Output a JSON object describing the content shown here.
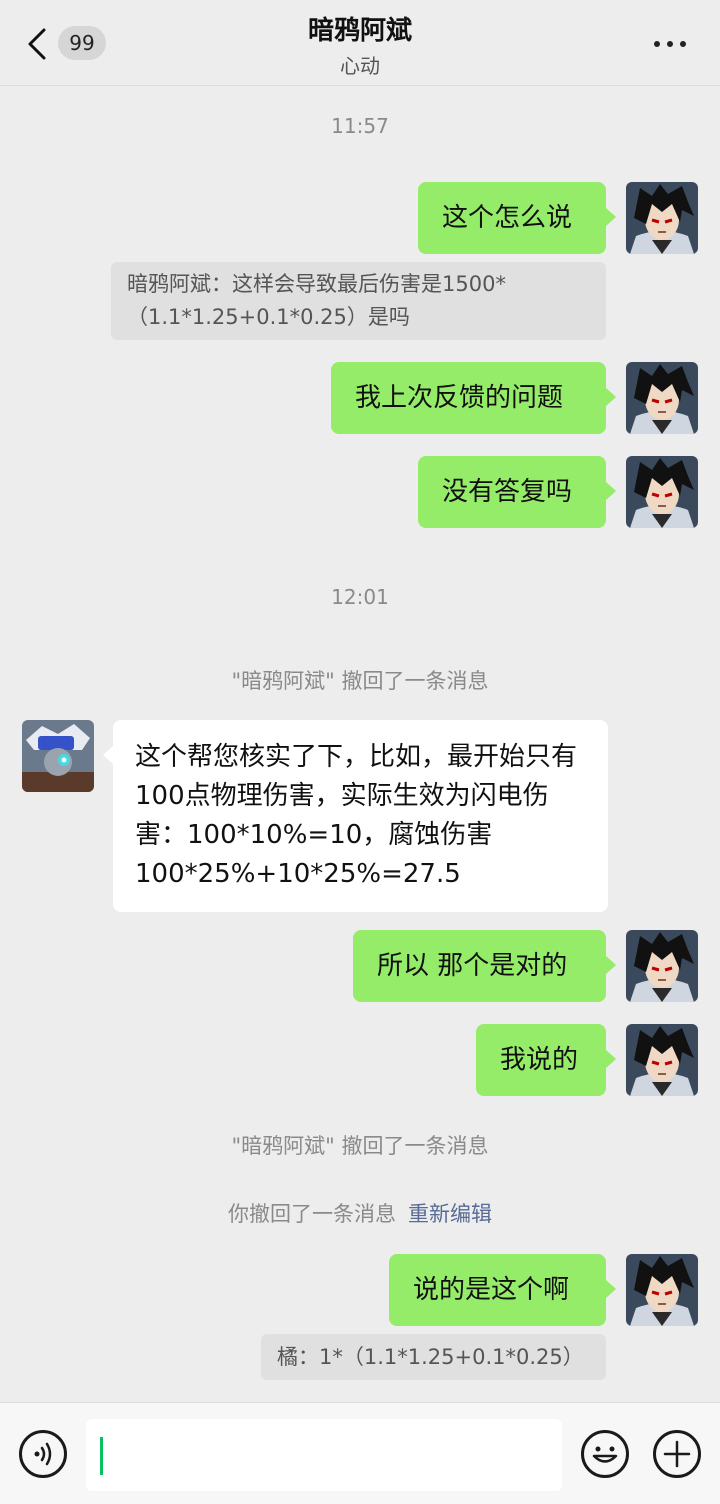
{
  "header": {
    "title": "暗鸦阿斌",
    "subtitle": "心动",
    "unread_badge": "99",
    "back_icon": "chevron-left-icon",
    "more_icon": "more-dots-icon"
  },
  "timestamps": [
    "11:57",
    "12:01"
  ],
  "messages": {
    "m1": "这个怎么说",
    "q1": "暗鸦阿斌：这样会导致最后伤害是1500*（1.1*1.25+0.1*0.25）是吗",
    "m2": "我上次反馈的问题",
    "m3": "没有答复吗",
    "recall1": "\"暗鸦阿斌\" 撤回了一条消息",
    "r1": "这个帮您核实了下，比如，最开始只有100点物理伤害，实际生效为闪电伤害：100*10%=10，腐蚀伤害100*25%+10*25%=27.5",
    "m4": "所以 那个是对的",
    "m5": "我说的",
    "recall2": "\"暗鸦阿斌\" 撤回了一条消息",
    "recall_self": "你撤回了一条消息",
    "reedit": "重新编辑",
    "m6": "说的是这个啊",
    "q2": "橘：1*（1.1*1.25+0.1*0.25）"
  },
  "input": {
    "voice_icon": "voice-icon",
    "emoji_icon": "emoji-icon",
    "plus_icon": "plus-icon",
    "value": ""
  },
  "colors": {
    "my_bubble": "#95ec69",
    "other_bubble": "#ffffff",
    "background": "#ededed",
    "link": "#576b95",
    "caret": "#07c160"
  }
}
